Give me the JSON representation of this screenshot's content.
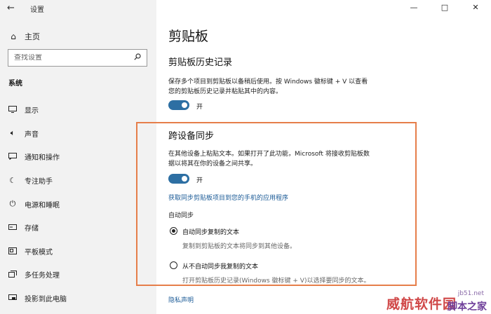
{
  "window": {
    "title": "设置",
    "back_icon": "back-arrow-icon",
    "controls": {
      "minimize": "—",
      "maximize": "□",
      "close": "✕"
    }
  },
  "sidebar": {
    "home_label": "主页",
    "search_placeholder": "查找设置",
    "section_label": "系统",
    "items": [
      {
        "label": "显示",
        "icon": "display-icon"
      },
      {
        "label": "声音",
        "icon": "sound-icon"
      },
      {
        "label": "通知和操作",
        "icon": "notification-icon"
      },
      {
        "label": "专注助手",
        "icon": "focus-assist-icon"
      },
      {
        "label": "电源和睡眠",
        "icon": "power-icon"
      },
      {
        "label": "存储",
        "icon": "storage-icon"
      },
      {
        "label": "平板模式",
        "icon": "tablet-mode-icon"
      },
      {
        "label": "多任务处理",
        "icon": "multitasking-icon"
      },
      {
        "label": "投影到此电脑",
        "icon": "project-icon"
      }
    ]
  },
  "main": {
    "title": "剪贴板",
    "history": {
      "heading": "剪贴板历史记录",
      "desc_line1": "保存多个项目到剪贴板以备稍后使用。按 Windows 徽标键 + V 以查看",
      "desc_line2": "您的剪贴板历史记录并粘贴其中的内容。",
      "toggle_label": "开",
      "toggle_on": true
    },
    "sync": {
      "heading": "跨设备同步",
      "desc_line1": "在其他设备上粘贴文本。如果打开了此功能，Microsoft 将接收剪贴板数",
      "desc_line2": "据以将其在你的设备之间共享。",
      "toggle_label": "开",
      "toggle_on": true,
      "link": "获取同步剪贴板项目到您的手机的应用程序",
      "auto_sync_label": "自动同步",
      "options": [
        {
          "label": "自动同步复制的文本",
          "desc": "复制到剪贴板的文本将同步到其他设备。",
          "selected": true
        },
        {
          "label": "从不自动同步我复制的文本",
          "desc": "打开剪贴板历史记录(Windows 徽标键 + V)以选择要同步的文本。",
          "selected": false
        }
      ]
    },
    "privacy_link": "隐私声明"
  },
  "highlight_color": "#e67e4a",
  "accent_color": "#2d6fa3",
  "watermark": {
    "site": "jb51.net",
    "text1": "威航软件园",
    "text2": "脚本之家"
  }
}
